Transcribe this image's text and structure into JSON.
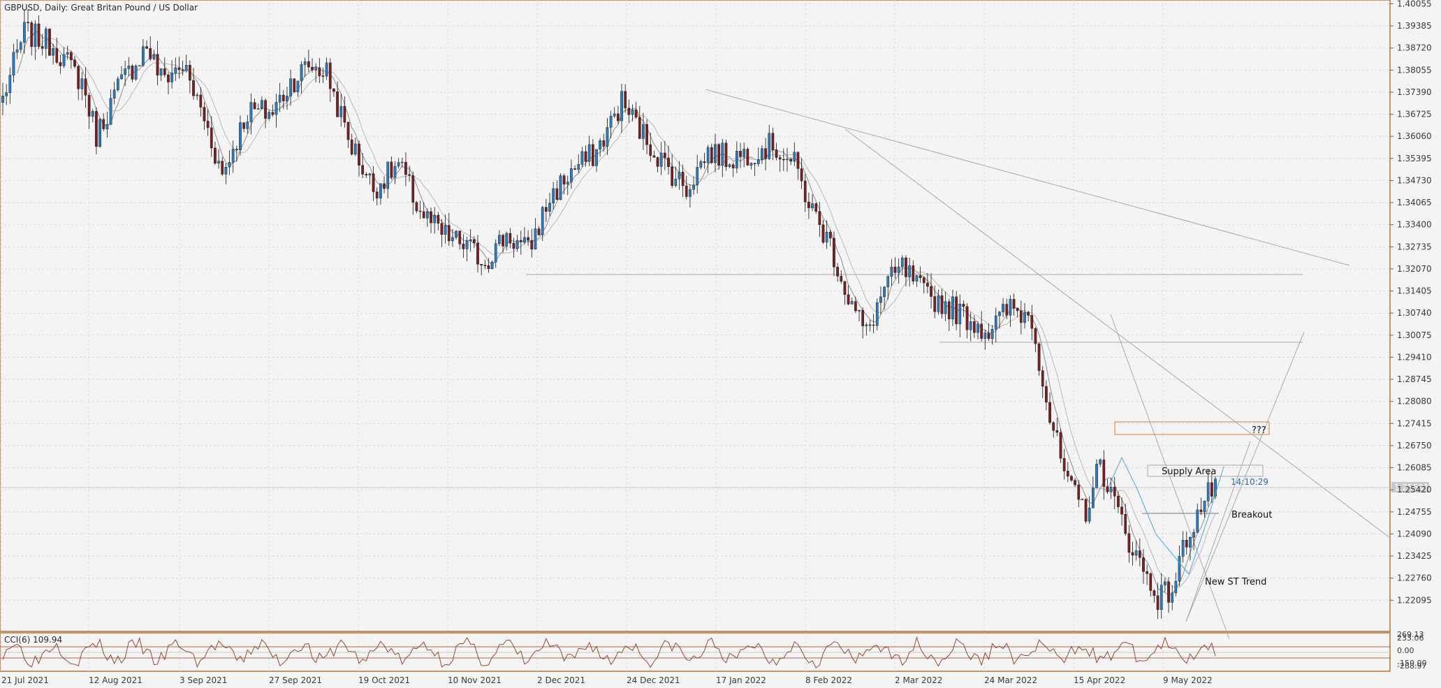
{
  "chart_data": {
    "type": "candlestick",
    "symbol": "GBPUSD",
    "timeframe": "Daily",
    "description": "Great Britan Pound / US Dollar",
    "title_line": "GBPUSD, Daily:  Great Britan Pound / US Dollar",
    "y_ticks": [
      "1.40055",
      "1.39385",
      "1.38720",
      "1.38055",
      "1.37390",
      "1.36725",
      "1.36060",
      "1.35395",
      "1.34730",
      "1.34065",
      "1.33400",
      "1.32735",
      "1.32070",
      "1.31405",
      "1.30740",
      "1.30075",
      "1.29410",
      "1.28745",
      "1.28080",
      "1.27415",
      "1.26750",
      "1.26085",
      "1.25420",
      "1.24755",
      "1.24090",
      "1.23425",
      "1.22760",
      "1.22095"
    ],
    "ylim": [
      1.2145,
      1.4006
    ],
    "x_date_labels": [
      "21 Jul 2021",
      "12 Aug 2021",
      "3 Sep 2021",
      "27 Sep 2021",
      "19 Oct 2021",
      "10 Nov 2021",
      "2 Dec 2021",
      "24 Dec 2021",
      "17 Jan 2022",
      "8 Feb 2022",
      "2 Mar 2022",
      "24 Mar 2022",
      "15 Apr 2022",
      "9 May 2022"
    ],
    "current_price": "1.25591",
    "countdown": "14:10:29",
    "price_path": [
      [
        0,
        1.372
      ],
      [
        6,
        1.392
      ],
      [
        14,
        1.388
      ],
      [
        22,
        1.377
      ],
      [
        26,
        1.361
      ],
      [
        32,
        1.375
      ],
      [
        40,
        1.388
      ],
      [
        44,
        1.378
      ],
      [
        50,
        1.382
      ],
      [
        56,
        1.366
      ],
      [
        61,
        1.349
      ],
      [
        68,
        1.368
      ],
      [
        75,
        1.368
      ],
      [
        80,
        1.377
      ],
      [
        85,
        1.382
      ],
      [
        90,
        1.38
      ],
      [
        96,
        1.36
      ],
      [
        103,
        1.345
      ],
      [
        110,
        1.352
      ],
      [
        116,
        1.338
      ],
      [
        122,
        1.331
      ],
      [
        128,
        1.328
      ],
      [
        134,
        1.323
      ],
      [
        140,
        1.331
      ],
      [
        146,
        1.326
      ],
      [
        152,
        1.342
      ],
      [
        158,
        1.35
      ],
      [
        165,
        1.356
      ],
      [
        172,
        1.371
      ],
      [
        178,
        1.361
      ],
      [
        184,
        1.352
      ],
      [
        190,
        1.345
      ],
      [
        196,
        1.356
      ],
      [
        202,
        1.354
      ],
      [
        208,
        1.356
      ],
      [
        214,
        1.358
      ],
      [
        220,
        1.352
      ],
      [
        225,
        1.338
      ],
      [
        230,
        1.328
      ],
      [
        235,
        1.312
      ],
      [
        240,
        1.301
      ],
      [
        245,
        1.315
      ],
      [
        250,
        1.321
      ],
      [
        256,
        1.313
      ],
      [
        262,
        1.31
      ],
      [
        268,
        1.306
      ],
      [
        274,
        1.302
      ],
      [
        280,
        1.309
      ],
      [
        286,
        1.306
      ],
      [
        291,
        1.276
      ],
      [
        296,
        1.255
      ],
      [
        301,
        1.248
      ],
      [
        305,
        1.262
      ],
      [
        309,
        1.25
      ],
      [
        313,
        1.239
      ],
      [
        317,
        1.23
      ],
      [
        321,
        1.222
      ],
      [
        325,
        1.224
      ],
      [
        329,
        1.24
      ],
      [
        333,
        1.249
      ],
      [
        337,
        1.256
      ]
    ],
    "indicator": {
      "name": "CCI(6)",
      "value": "109.94",
      "levels": [
        "269.13",
        "233.06",
        "0.00",
        "-150.00",
        "-288.97"
      ]
    },
    "annotations": {
      "supply_area": "Supply Area",
      "question": "???",
      "breakout": "Breakout",
      "new_trend": "New ST Trend"
    },
    "colors": {
      "bull": "#2b7bc0",
      "bear": "#7a1f1f",
      "frame": "#b5733a",
      "grid": "#d6d6d6",
      "ma": "#8f8f8f",
      "trendline": "#a9a9a9",
      "box": "#e07a2a",
      "cci": "#8b3a1a",
      "timer": "#2a6aa8"
    }
  }
}
